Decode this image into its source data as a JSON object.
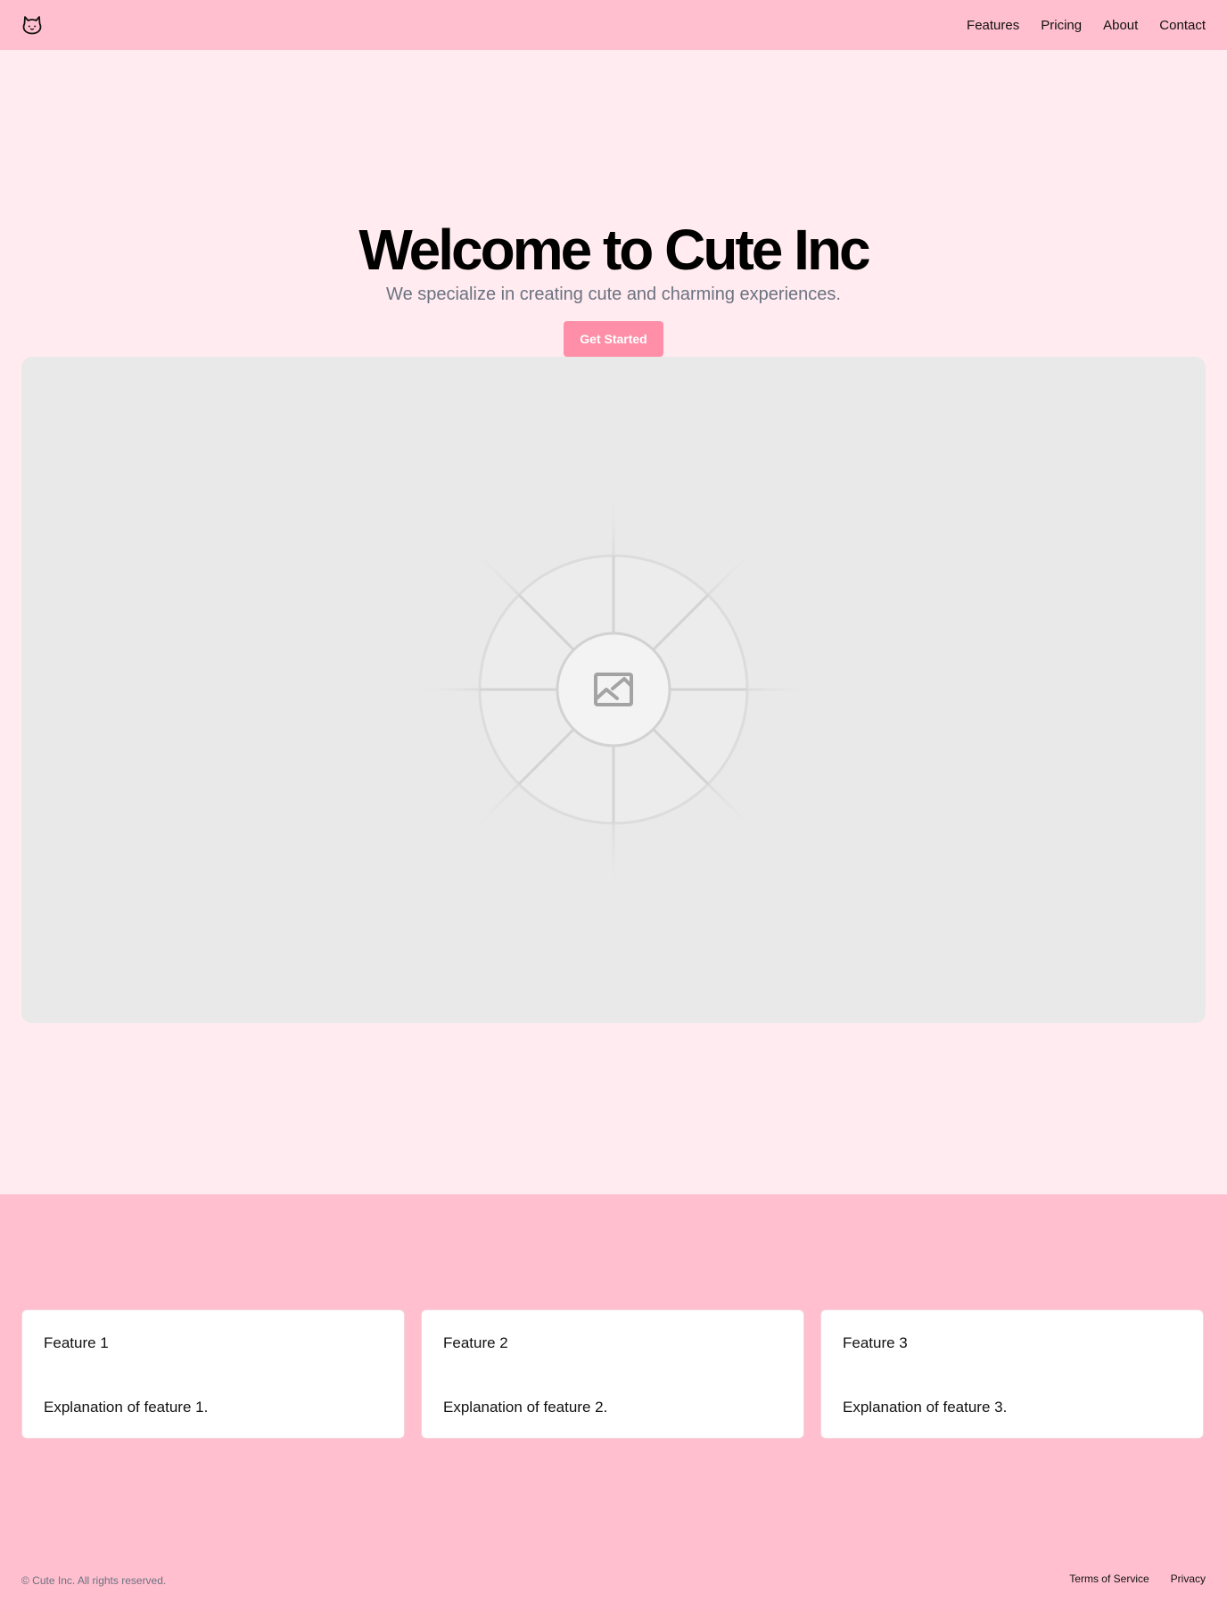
{
  "header": {
    "logo_icon": "cat-face-icon",
    "nav": [
      "Features",
      "Pricing",
      "About",
      "Contact"
    ]
  },
  "hero": {
    "title": "Welcome to Cute Inc",
    "subtitle": "We specialize in creating cute and charming experiences.",
    "cta_label": "Get Started",
    "image_icon": "image-placeholder-icon"
  },
  "features": [
    {
      "title": "Feature 1",
      "description": "Explanation of feature 1."
    },
    {
      "title": "Feature 2",
      "description": "Explanation of feature 2."
    },
    {
      "title": "Feature 3",
      "description": "Explanation of feature 3."
    }
  ],
  "footer": {
    "copyright": "© Cute Inc. All rights reserved.",
    "links": [
      "Terms of Service",
      "Privacy"
    ]
  },
  "colors": {
    "header_bg": "#ffbfce",
    "page_bg": "#ffebf0",
    "accent": "#ff8fa8",
    "subtitle_text": "#6b7280"
  }
}
